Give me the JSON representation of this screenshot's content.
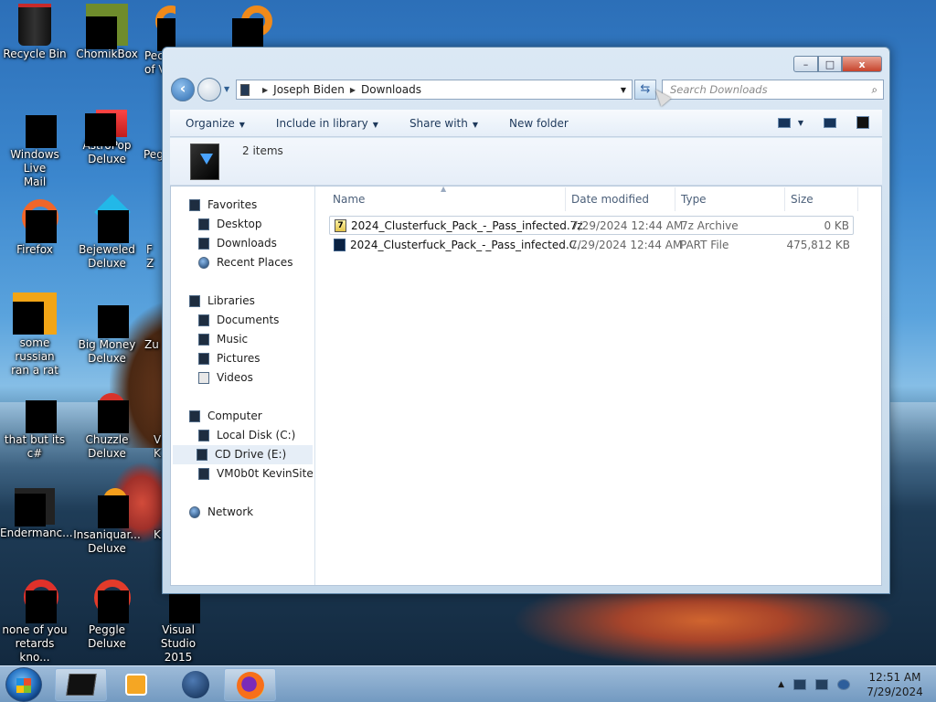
{
  "desktop": {
    "icons": [
      {
        "label": "Recycle Bin",
        "x": 0,
        "y": 0
      },
      {
        "label": "ChomikBox"
      },
      {
        "label": "Pec\nof V"
      },
      {
        "label": ""
      },
      {
        "label": "Windows Live\nMail"
      },
      {
        "label": "AstroPop\nDeluxe"
      },
      {
        "label": "Pegg"
      },
      {
        "label": "Firefox"
      },
      {
        "label": "Bejeweled\nDeluxe"
      },
      {
        "label": "F\nZ"
      },
      {
        "label": "some russian\nran a rat"
      },
      {
        "label": "Big Money\nDeluxe"
      },
      {
        "label": "Zu"
      },
      {
        "label": "that but its c#"
      },
      {
        "label": "Chuzzle\nDeluxe"
      },
      {
        "label": "V\nK"
      },
      {
        "label": "Endermanc..."
      },
      {
        "label": "Insaniquar...\nDeluxe"
      },
      {
        "label": "K"
      },
      {
        "label": "none of you\nretards kno..."
      },
      {
        "label": "Peggle Deluxe"
      },
      {
        "label": "Visual Studio\n2015"
      }
    ]
  },
  "window": {
    "address": {
      "crumbs": [
        "Joseph Biden",
        "Downloads"
      ]
    },
    "search_placeholder": "Search Downloads",
    "controls": {
      "minimize": "–",
      "maximize": "□",
      "close": "x"
    },
    "toolbar": {
      "organize": "Organize",
      "include_in_library": "Include in library",
      "share_with": "Share with",
      "new_folder": "New folder"
    },
    "info": {
      "count": "2 items"
    },
    "nav": {
      "favorites": "Favorites",
      "desktop": "Desktop",
      "downloads": "Downloads",
      "recent_places": "Recent Places",
      "libraries": "Libraries",
      "documents": "Documents",
      "music": "Music",
      "pictures": "Pictures",
      "videos": "Videos",
      "computer": "Computer",
      "local_disk": "Local Disk (C:)",
      "cd_drive": "CD Drive (E:)",
      "vm": "VM0b0t KevinSite",
      "network": "Network"
    },
    "columns": {
      "name": "Name",
      "date": "Date modified",
      "type": "Type",
      "size": "Size"
    },
    "files": [
      {
        "name": "2024_Clusterfuck_Pack_-_Pass_infected.7z",
        "date": "7/29/2024 12:44 AM",
        "type": "7z Archive",
        "size": "0 KB",
        "icon": "7z-icon"
      },
      {
        "name": "2024_Clusterfuck_Pack_-_Pass_infected.C...",
        "date": "7/29/2024 12:44 AM",
        "type": "PART File",
        "size": "475,812 KB",
        "icon": "part-file-icon"
      }
    ]
  },
  "taskbar": {
    "clock_time": "12:51 AM",
    "clock_date": "7/29/2024",
    "tray_arrow": "▲"
  }
}
